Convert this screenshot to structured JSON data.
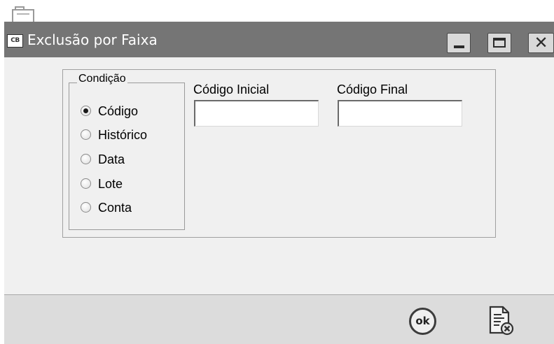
{
  "window": {
    "title": "Exclusão por Faixa",
    "app_icon_text": "CB"
  },
  "condition_group": {
    "legend": "Condição",
    "options": [
      {
        "label": "Código",
        "checked": true
      },
      {
        "label": "Histórico",
        "checked": false
      },
      {
        "label": "Data",
        "checked": false
      },
      {
        "label": "Lote",
        "checked": false
      },
      {
        "label": "Conta",
        "checked": false
      }
    ]
  },
  "fields": {
    "initial_label": "Código Inicial",
    "initial_value": "",
    "final_label": "Código Final",
    "final_value": ""
  },
  "footer": {
    "ok_label": "ok"
  },
  "icons": {
    "background": "printer-icon",
    "app": "app-logo-icon",
    "minimize": "minimize-icon",
    "maximize": "maximize-icon",
    "close": "close-icon",
    "ok": "ok-icon",
    "cancel": "cancel-document-icon"
  },
  "colors": {
    "titlebar": "#757575",
    "body": "#f0f0f0",
    "footer": "#dcdcdc"
  }
}
